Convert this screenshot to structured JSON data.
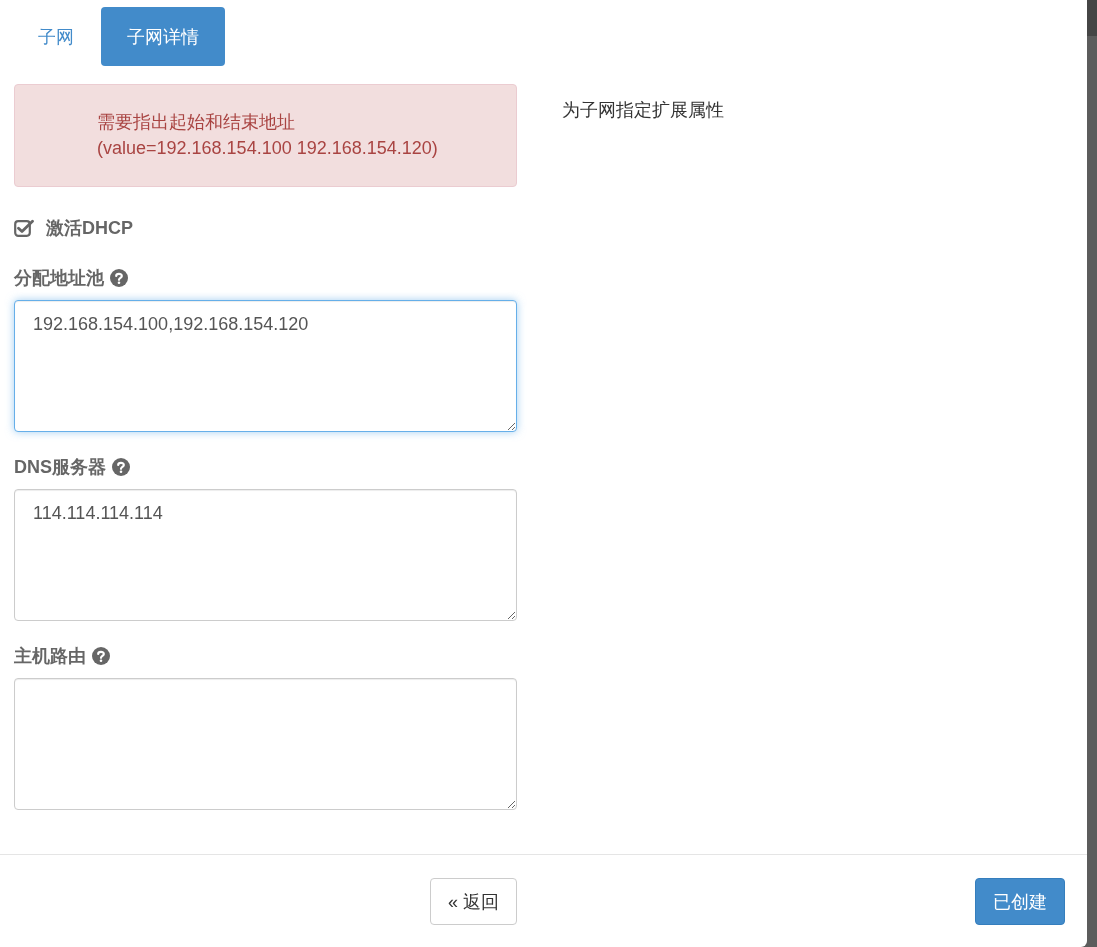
{
  "tabs": [
    {
      "label": "子网",
      "selected": false
    },
    {
      "label": "子网详情",
      "selected": true
    }
  ],
  "alert": {
    "message": "需要指出起始和结束地址\n(value=192.168.154.100 192.168.154.120)"
  },
  "dhcp": {
    "label": "激活DHCP",
    "checked": true
  },
  "fields": [
    {
      "label": "分配地址池",
      "value": "192.168.154.100,192.168.154.120",
      "focused": true
    },
    {
      "label": "DNS服务器",
      "value": "114.114.114.114",
      "focused": false
    },
    {
      "label": "主机路由",
      "focused": false
    }
  ],
  "description": "为子网指定扩展属性",
  "footer_buttons": [
    {
      "label": "« 返回",
      "kind": "default"
    },
    {
      "label": "已创建",
      "kind": "primary"
    }
  ]
}
